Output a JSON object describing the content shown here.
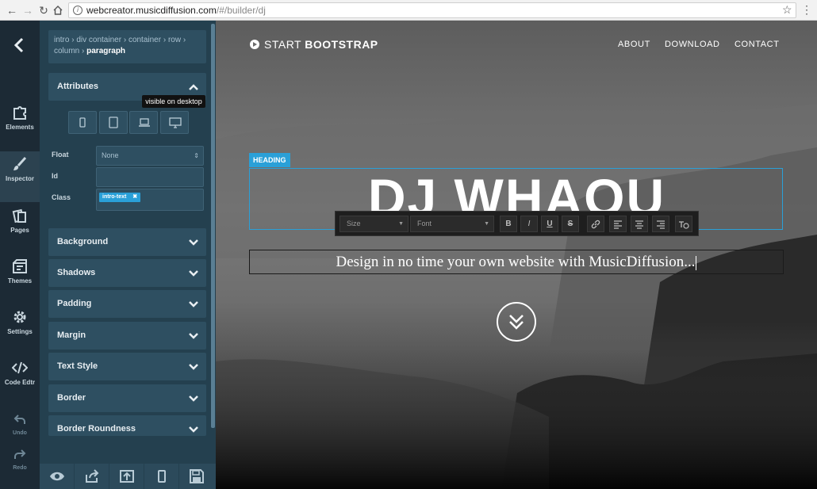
{
  "browser": {
    "url_host": "webcreator.musicdiffusion.com",
    "url_path": "/#/builder/dj"
  },
  "rail": {
    "items": [
      {
        "label": "Elements"
      },
      {
        "label": "Inspector"
      },
      {
        "label": "Pages"
      },
      {
        "label": "Themes"
      },
      {
        "label": "Settings"
      },
      {
        "label": "Code Edtr"
      }
    ],
    "undo": "Undo",
    "redo": "Redo"
  },
  "inspector": {
    "breadcrumb": [
      "intro",
      "div container",
      "container",
      "row",
      "column"
    ],
    "breadcrumb_current": "paragraph",
    "attributes_title": "Attributes",
    "tooltip": "visible on desktop",
    "float_label": "Float",
    "float_value": "None",
    "id_label": "Id",
    "id_value": "",
    "class_label": "Class",
    "class_tag": "intro-text",
    "sections": [
      "Background",
      "Shadows",
      "Padding",
      "Margin",
      "Text Style",
      "Border",
      "Border Roundness"
    ]
  },
  "preview": {
    "brand_light": "START",
    "brand_bold": "BOOTSTRAP",
    "nav": [
      "ABOUT",
      "DOWNLOAD",
      "CONTACT"
    ],
    "heading_tag": "HEADING",
    "heading": "DJ WHAOU",
    "toolbar": {
      "size_placeholder": "Size",
      "font_placeholder": "Font",
      "bold": "B",
      "italic": "I",
      "underline": "U",
      "strike": "S"
    },
    "subtitle": "Design in no time your own website with MusicDiffusion..."
  },
  "colors": {
    "accent": "#2aa0d8",
    "rail_bg": "#1c2a35",
    "panel_bg": "#24404f",
    "section_bg": "#2e4f61"
  }
}
